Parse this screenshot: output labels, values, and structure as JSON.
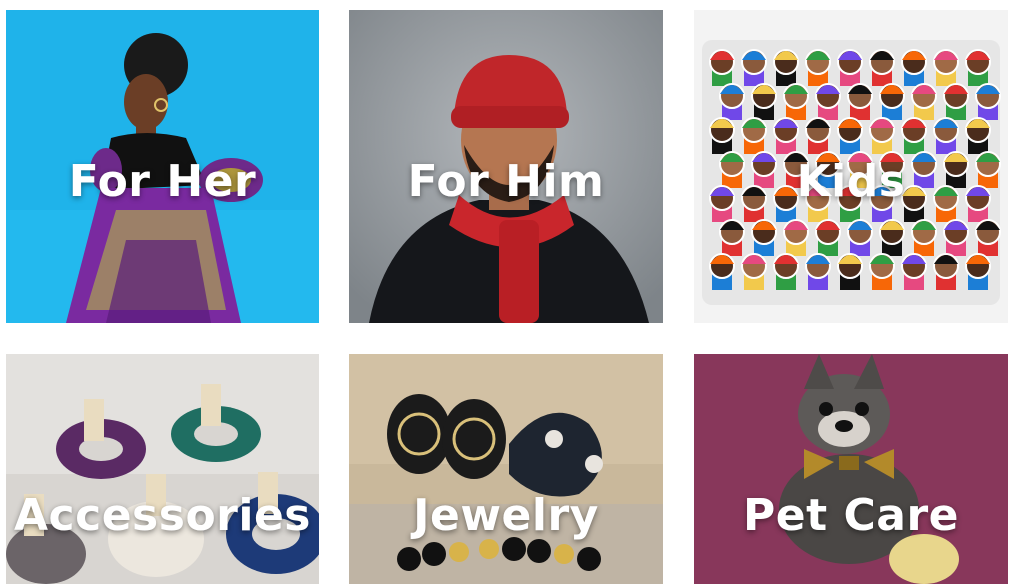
{
  "categories": [
    {
      "label": "For Her"
    },
    {
      "label": "For Him"
    },
    {
      "label": "Kids"
    },
    {
      "label": "Accessories"
    },
    {
      "label": "Jewelry"
    },
    {
      "label": "Pet Care"
    }
  ],
  "colors": {
    "for_her_bg": "#21b6ec",
    "for_him_bg": "#9aa0a6",
    "kids_bg": "#f4f4f4",
    "accessories_bg": "#d9d6d2",
    "jewelry_bg": "#b7a891",
    "pet_care_bg": "#8f3b5f"
  }
}
